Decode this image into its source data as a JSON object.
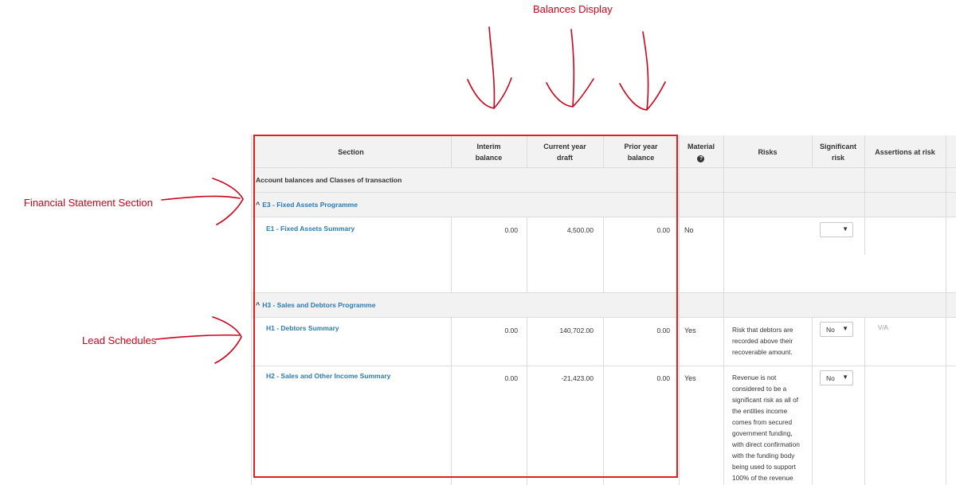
{
  "annotations": {
    "balances": "Balances Display",
    "fs_section": "Financial Statement Section",
    "lead_schedules": "Lead Schedules"
  },
  "headers": {
    "section": "Section",
    "interim_1": "Interim",
    "interim_2": "balance",
    "current_1": "Current year",
    "current_2": "draft",
    "prior_1": "Prior year",
    "prior_2": "balance",
    "material": "Material",
    "help_icon": "?",
    "risks": "Risks",
    "significant_1": "Significant",
    "significant_2": "risk",
    "assertions": "Assertions at risk"
  },
  "group_label": "Account balances and Classes of transaction",
  "sections": {
    "e3": {
      "title": "E3 - Fixed Assets Programme",
      "chevron": "^"
    },
    "h3": {
      "title": "H3 - Sales and Debtors Programme",
      "chevron": "^"
    }
  },
  "rows": {
    "e1": {
      "name": "E1 - Fixed Assets Summary",
      "interim": "0.00",
      "current": "4,500.00",
      "prior": "0.00",
      "material": "No",
      "risk": "",
      "significant": "",
      "assertions": ""
    },
    "h1": {
      "name": "H1 - Debtors Summary",
      "interim": "0.00",
      "current": "140,702.00",
      "prior": "0.00",
      "material": "Yes",
      "risk": "Risk that debtors are recorded above their recoverable amount.",
      "significant": "No",
      "assertions": "V/A"
    },
    "h2": {
      "name": "H2 - Sales and Other Income Summary",
      "interim": "0.00",
      "current": "-21,423.00",
      "prior": "0.00",
      "material": "Yes",
      "risk": "Revenue is not considered to be a significant risk as all of the entities income comes from secured government funding, with direct confirmation with the funding body being used to support 100% of the revenue",
      "significant": "No",
      "assertions": ""
    }
  },
  "select_caret": "▼",
  "colors": {
    "annotation": "#d0021b",
    "link": "#2a7ab8",
    "highlight_box": "#e02020"
  }
}
